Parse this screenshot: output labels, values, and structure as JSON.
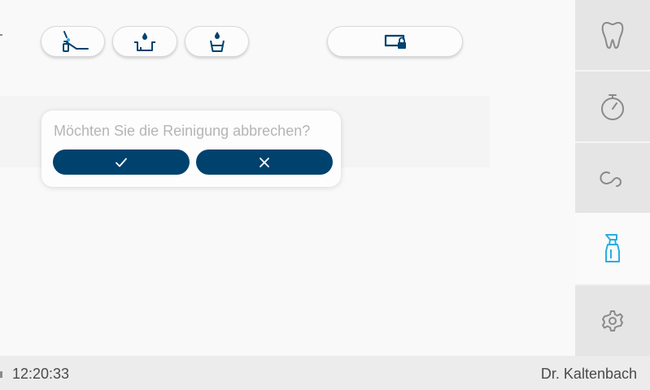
{
  "toolbar": {
    "buttons": [
      {
        "icon": "chair-spray-icon"
      },
      {
        "icon": "basin-drop-icon"
      },
      {
        "icon": "cup-drop-icon"
      },
      {
        "icon": "screen-lock-icon"
      }
    ]
  },
  "dialog": {
    "message": "Möchten Sie die Reinigung abbrechen?",
    "confirm_icon": "check-icon",
    "cancel_icon": "close-icon"
  },
  "sidebar": {
    "tabs": [
      {
        "icon": "tooth-icon",
        "active": false
      },
      {
        "icon": "stopwatch-icon",
        "active": false
      },
      {
        "icon": "loop-icon",
        "active": false
      },
      {
        "icon": "spray-bottle-icon",
        "active": true
      },
      {
        "icon": "gear-icon",
        "active": false
      }
    ]
  },
  "status": {
    "time": "12:20:33",
    "user": "Dr. Kaltenbach"
  },
  "colors": {
    "primary": "#00426e",
    "accent": "#29aee0",
    "icon_gray": "#8a8a8a",
    "text": "#4a4a4a"
  }
}
